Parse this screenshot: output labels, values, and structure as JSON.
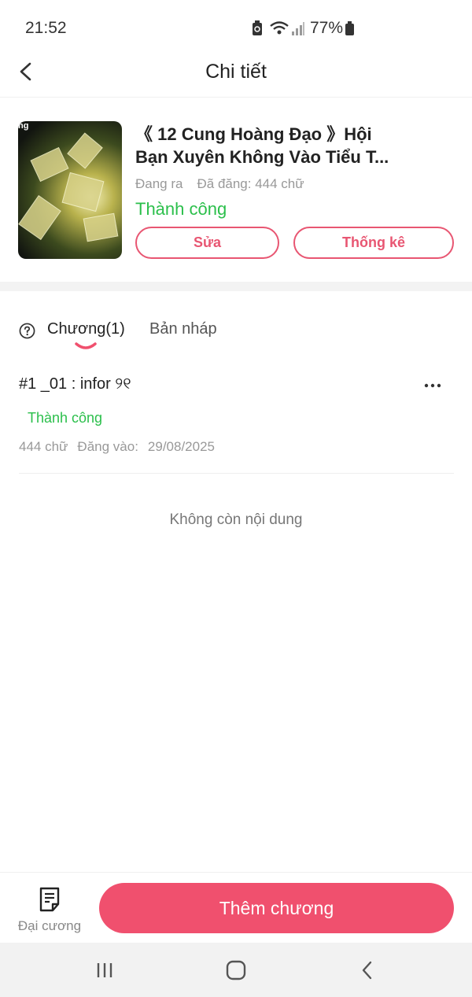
{
  "status_bar": {
    "time": "21:52",
    "battery": "77%"
  },
  "header": {
    "title": "Chi tiết"
  },
  "book": {
    "title": "《 12 Cung Hoàng Đạo 》Hội Bạn Xuyên Không Vào Tiểu T...",
    "cover_tag": "ng",
    "state": "Đang ra",
    "published": "Đã đăng: 444 chữ",
    "status": "Thành công",
    "edit_label": "Sửa",
    "stats_label": "Thống kê"
  },
  "tabs": {
    "chapters": "Chương(1)",
    "drafts": "Bản nháp"
  },
  "chapters": [
    {
      "title": "#1  _01 : infor ୨୧",
      "status": "Thành công",
      "words": "444 chữ",
      "posted_label": "Đăng vào:",
      "posted_date": "29/08/2025"
    }
  ],
  "end_text": "Không còn nội dung",
  "bottom": {
    "outline_label": "Đại cương",
    "add_label": "Thêm chương"
  },
  "colors": {
    "accent": "#f0506e",
    "success": "#2bbf4b"
  },
  "icons": [
    "back-icon",
    "help-icon",
    "more-icon",
    "outline-icon",
    "recents-icon",
    "home-icon",
    "nav-back-icon"
  ]
}
